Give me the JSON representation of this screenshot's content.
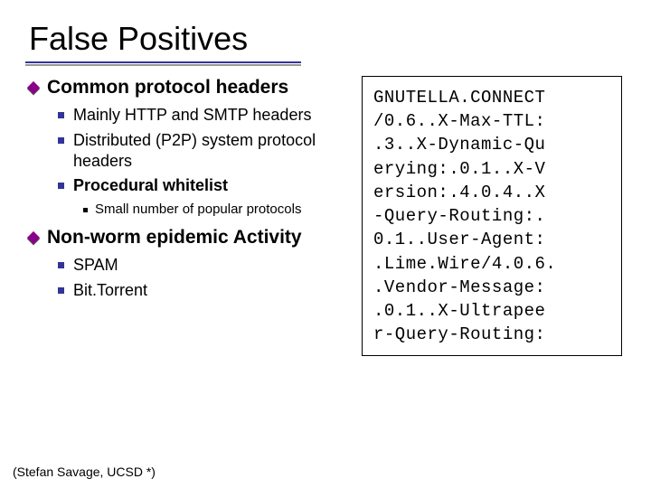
{
  "title": "False Positives",
  "left": {
    "h1": "Common protocol headers",
    "h1_items": [
      {
        "text": "Mainly HTTP and SMTP headers",
        "bold": false
      },
      {
        "text": "Distributed (P2P) system protocol headers",
        "bold": false
      },
      {
        "text": "Procedural whitelist",
        "bold": true
      }
    ],
    "h1_sub": "Small number of popular protocols",
    "h2": "Non-worm epidemic Activity",
    "h2_items": [
      {
        "text": "SPAM"
      },
      {
        "text": "Bit.Torrent"
      }
    ]
  },
  "right_lines": [
    "GNUTELLA.CONNECT",
    "/0.6..X-Max-TTL:",
    ".3..X-Dynamic-Qu",
    "erying:.0.1..X-V",
    "ersion:.4.0.4..X",
    "-Query-Routing:.",
    "0.1..User-Agent:",
    ".Lime.Wire/4.0.6.",
    ".Vendor-Message:",
    ".0.1..X-Ultrapee",
    "r-Query-Routing:"
  ],
  "footer": "(Stefan Savage, UCSD *)",
  "meta_note": "slide from presentation"
}
